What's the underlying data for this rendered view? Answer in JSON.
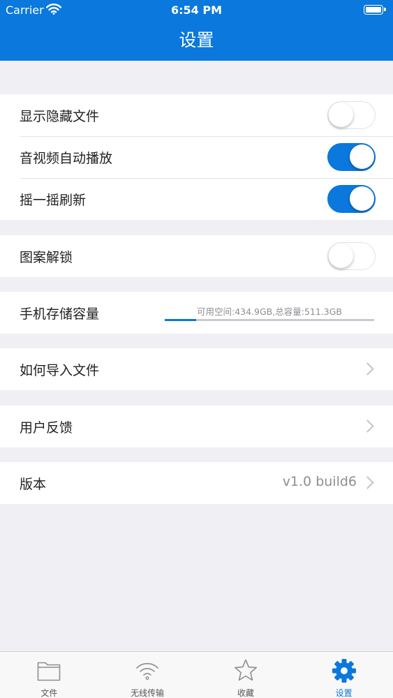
{
  "status_bar": {
    "carrier": "Carrier",
    "time": "6:54 PM"
  },
  "header": {
    "title": "设置"
  },
  "settings": {
    "show_hidden_files": {
      "label": "显示隐藏文件",
      "enabled": false
    },
    "autoplay_media": {
      "label": "音视频自动播放",
      "enabled": true
    },
    "shake_refresh": {
      "label": "摇一摇刷新",
      "enabled": true
    },
    "pattern_unlock": {
      "label": "图案解锁",
      "enabled": false
    },
    "storage": {
      "label": "手机存储容量",
      "info": "可用空间:434.9GB,总容量:511.3GB",
      "used_fraction": 0.1494
    },
    "import_help": {
      "label": "如何导入文件"
    },
    "feedback": {
      "label": "用户反馈"
    },
    "version": {
      "label": "版本",
      "value": "v1.0 build6"
    }
  },
  "tabbar": {
    "tabs": [
      {
        "label": "文件",
        "icon": "folder-icon",
        "active": false
      },
      {
        "label": "无线传输",
        "icon": "wifi-icon",
        "active": false
      },
      {
        "label": "收藏",
        "icon": "star-icon",
        "active": false
      },
      {
        "label": "设置",
        "icon": "gear-icon",
        "active": true
      }
    ]
  },
  "colors": {
    "accent": "#0a78dc",
    "background": "#efeff4",
    "inactive_tab": "#8e8e93"
  }
}
